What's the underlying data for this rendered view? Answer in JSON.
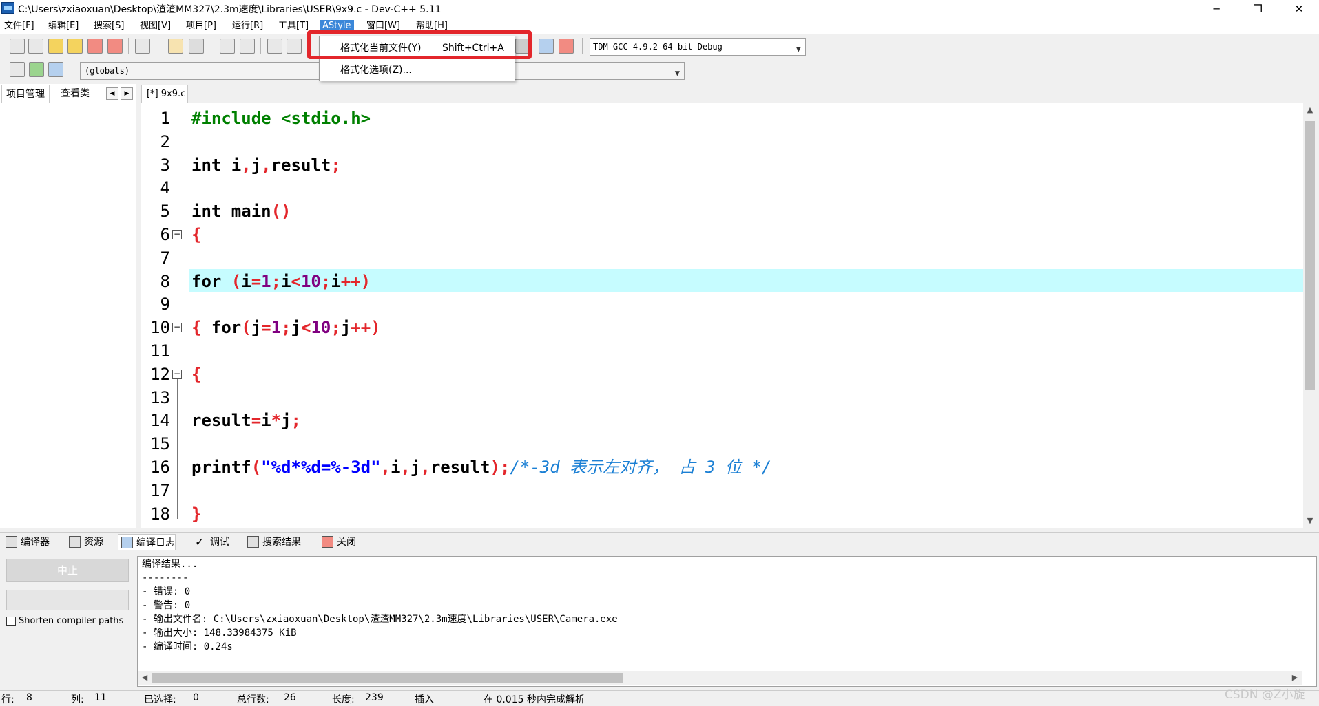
{
  "window": {
    "title": "C:\\Users\\zxiaoxuan\\Desktop\\渣渣MM327\\2.3m速度\\Libraries\\USER\\9x9.c - Dev-C++ 5.11",
    "minimize": "─",
    "restore": "❐",
    "close": "✕"
  },
  "menubar": [
    "文件[F]",
    "编辑[E]",
    "搜索[S]",
    "视图[V]",
    "项目[P]",
    "运行[R]",
    "工具[T]",
    "AStyle",
    "窗口[W]",
    "帮助[H]"
  ],
  "dropdown": {
    "items": [
      {
        "label": "格式化当前文件(Y)",
        "shortcut": "Shift+Ctrl+A"
      },
      {
        "label": "格式化选项(Z)...",
        "shortcut": ""
      }
    ],
    "highlight_color": "#e3262b"
  },
  "toolbar": {
    "compiler": "TDM-GCC 4.9.2 64-bit Debug",
    "scope": "(globals)"
  },
  "left_panel": {
    "tabs": [
      "项目管理",
      "查看类"
    ],
    "prev": "◀",
    "next": "▶"
  },
  "editor": {
    "tab": "[*] 9x9.c",
    "highlight_color": "#c6fcff",
    "line_numbers": [
      "1",
      "2",
      "3",
      "4",
      "5",
      "6",
      "7",
      "8",
      "9",
      "10",
      "11",
      "12",
      "13",
      "14",
      "15",
      "16",
      "17",
      "18"
    ],
    "lines": [
      [
        {
          "t": "#include <stdio.h>",
          "c": "pp"
        }
      ],
      [],
      [
        {
          "t": "int i",
          "c": "kw"
        },
        {
          "t": ",",
          "c": "pn"
        },
        {
          "t": "j",
          "c": "kw"
        },
        {
          "t": ",",
          "c": "pn"
        },
        {
          "t": "result",
          "c": "kw"
        },
        {
          "t": ";",
          "c": "pn"
        }
      ],
      [],
      [
        {
          "t": "int main",
          "c": "kw"
        },
        {
          "t": "()",
          "c": "pn"
        }
      ],
      [
        {
          "t": "{",
          "c": "pn"
        }
      ],
      [],
      [
        {
          "t": "for ",
          "c": "kw"
        },
        {
          "t": "(",
          "c": "pn"
        },
        {
          "t": "i",
          "c": "kw"
        },
        {
          "t": "=",
          "c": "pn"
        },
        {
          "t": "1",
          "c": "num"
        },
        {
          "t": ";",
          "c": "pn"
        },
        {
          "t": "i",
          "c": "kw"
        },
        {
          "t": "<",
          "c": "pn"
        },
        {
          "t": "10",
          "c": "num"
        },
        {
          "t": ";",
          "c": "pn"
        },
        {
          "t": "i",
          "c": "kw"
        },
        {
          "t": "++)",
          "c": "pn"
        }
      ],
      [],
      [
        {
          "t": "{ ",
          "c": "pn"
        },
        {
          "t": "for",
          "c": "kw"
        },
        {
          "t": "(",
          "c": "pn"
        },
        {
          "t": "j",
          "c": "kw"
        },
        {
          "t": "=",
          "c": "pn"
        },
        {
          "t": "1",
          "c": "num"
        },
        {
          "t": ";",
          "c": "pn"
        },
        {
          "t": "j",
          "c": "kw"
        },
        {
          "t": "<",
          "c": "pn"
        },
        {
          "t": "10",
          "c": "num"
        },
        {
          "t": ";",
          "c": "pn"
        },
        {
          "t": "j",
          "c": "kw"
        },
        {
          "t": "++)",
          "c": "pn"
        }
      ],
      [],
      [
        {
          "t": "{",
          "c": "pn"
        }
      ],
      [],
      [
        {
          "t": "result",
          "c": "kw"
        },
        {
          "t": "=",
          "c": "pn"
        },
        {
          "t": "i",
          "c": "kw"
        },
        {
          "t": "*",
          "c": "pn"
        },
        {
          "t": "j",
          "c": "kw"
        },
        {
          "t": ";",
          "c": "pn"
        }
      ],
      [],
      [
        {
          "t": "printf",
          "c": "kw"
        },
        {
          "t": "(",
          "c": "pn"
        },
        {
          "t": "\"%d*%d=%-3d\"",
          "c": "str"
        },
        {
          "t": ",",
          "c": "pn"
        },
        {
          "t": "i",
          "c": "kw"
        },
        {
          "t": ",",
          "c": "pn"
        },
        {
          "t": "j",
          "c": "kw"
        },
        {
          "t": ",",
          "c": "pn"
        },
        {
          "t": "result",
          "c": "kw"
        },
        {
          "t": ");",
          "c": "pn"
        },
        {
          "t": "/*-3d 表示左对齐， 占 3 位 */",
          "c": "cm"
        }
      ],
      [],
      [
        {
          "t": "}",
          "c": "pn"
        }
      ]
    ]
  },
  "bottom_tabs": [
    "编译器",
    "资源",
    "编译日志",
    "调试",
    "搜索结果",
    "关闭"
  ],
  "compile_panel": {
    "stop_button": "中止",
    "shorten_label": "Shorten compiler paths",
    "log": [
      "编译结果...",
      "--------",
      "- 错误: 0",
      "- 警告: 0",
      "- 输出文件名: C:\\Users\\zxiaoxuan\\Desktop\\渣渣MM327\\2.3m速度\\Libraries\\USER\\Camera.exe",
      "- 输出大小: 148.33984375 KiB",
      "- 编译时间: 0.24s"
    ]
  },
  "status": {
    "row_label": "行:",
    "row": "8",
    "col_label": "列:",
    "col": "11",
    "sel_label": "已选择:",
    "sel": "0",
    "total_label": "总行数:",
    "total": "26",
    "len_label": "长度:",
    "len": "239",
    "mode": "插入",
    "parse": "在 0.015 秒内完成解析"
  },
  "watermark": "CSDN @Z小旋"
}
